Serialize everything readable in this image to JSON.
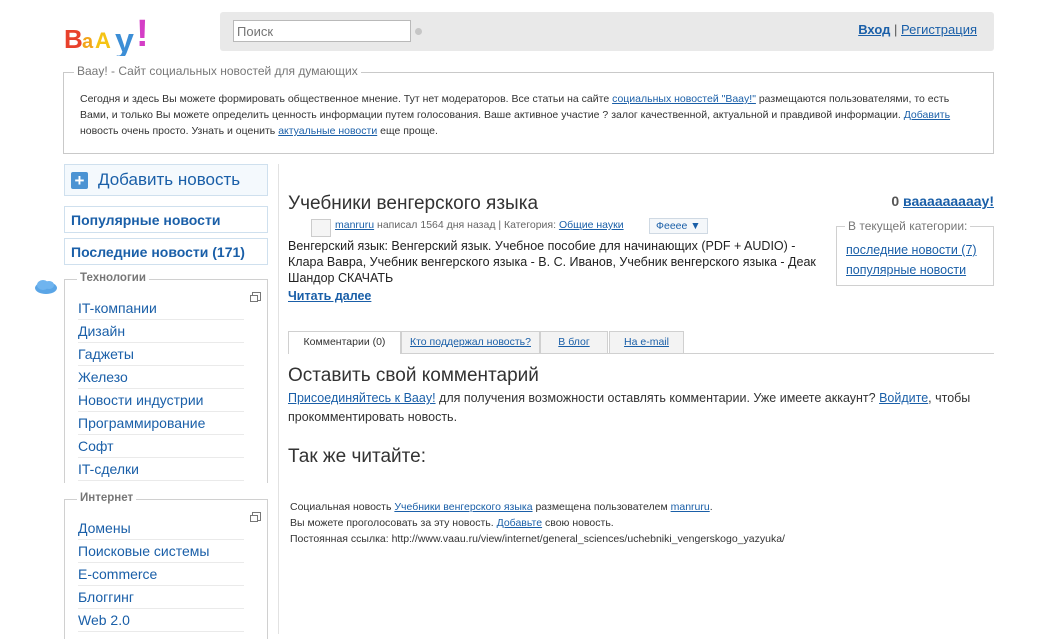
{
  "header": {
    "logo_text": "BaAy!",
    "search_placeholder": "Поиск",
    "login": "Вход",
    "separator": "|",
    "register": "Регистрация"
  },
  "intro": {
    "legend": "Baay! - Сайт социальных новостей для думающих",
    "text1": "Сегодня и здесь Вы можете формировать общественное мнение. Тут нет модераторов. Все статьи на сайте ",
    "link1": "социальных новостей \"Baay!\"",
    "text2": " размещаются пользователями, то есть Вами, и только Вы можете определить ценность информации путем голосования. Ваше активное участие ? залог качественной, актуальной и правдивой информации. ",
    "link2": "Добавить",
    "text3": " новость очень просто. Узнать и оценить ",
    "link3": "актуальные новости",
    "text4": " еще проще."
  },
  "sidebar": {
    "add_news": "Добавить новость",
    "popular": "Популярные новости",
    "latest": "Последние новости (171)",
    "tech": {
      "title": "Технологии",
      "items": [
        "IT-компании",
        "Дизайн",
        "Гаджеты",
        "Железо",
        "Новости индустрии",
        "Программирование",
        "Софт",
        "IT-сделки"
      ]
    },
    "net": {
      "title": "Интернет",
      "items": [
        "Домены",
        "Поисковые системы",
        "E-commerce",
        "Блоггинг",
        "Web 2.0"
      ]
    }
  },
  "article": {
    "title": "Учебники венгерского языка",
    "vote_count": "0",
    "vote_label": "вааааааааау!",
    "author": "manruru",
    "meta_text": " написал 1564 дня назад | Категория: ",
    "category": "Общие науки",
    "feee": "Фееее ▼",
    "body": "Венгерский язык: Венгерский язык. Учебное пособие для начинающих (PDF + AUDIO) - Клара Вавра, Учебник венгерского языка - В. С. Иванов, Учебник венгерского языка - Деак Шандор СКАЧАТЬ",
    "read_more": "Читать далее"
  },
  "in_category": {
    "legend": "В текущей категории:",
    "latest": "последние новости (7)",
    "popular": "популярные новости"
  },
  "tabs": [
    "Комментарии (0)",
    "Кто поддержал новость?",
    "В блог",
    "На e-mail"
  ],
  "comment": {
    "title": "Оставить свой комментарий",
    "join": "Присоединяйтесь к Baay!",
    "text1": " для получения возможности оставлять комментарии. Уже имеете аккаунт? ",
    "login": "Войдите",
    "text2": ", чтобы прокомментировать новость."
  },
  "also_read": "Так же читайте:",
  "footer_info": {
    "l1_a": "Социальная новость ",
    "l1_link": "Учебники венгерского языка",
    "l1_b": " размещена пользователем ",
    "l1_user": "manruru",
    "l1_c": ".",
    "l2_a": "Вы можете проголосовать за эту новость. ",
    "l2_link": "Добавьте",
    "l2_b": " свою новость.",
    "l3": "Постоянная ссылка: http://www.vaau.ru/view/internet/general_sciences/uchebniki_vengerskogo_yazyuka/"
  },
  "colors": {
    "link": "#1a5fa8",
    "header_bg": "#e9e9e9"
  }
}
